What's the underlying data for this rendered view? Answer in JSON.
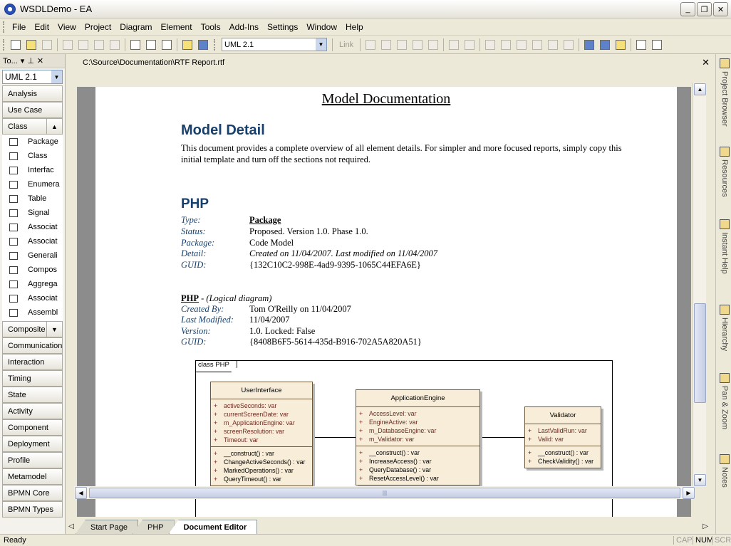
{
  "window": {
    "title": "WSDLDemo - EA"
  },
  "menu": [
    "File",
    "Edit",
    "View",
    "Project",
    "Diagram",
    "Element",
    "Tools",
    "Add-Ins",
    "Settings",
    "Window",
    "Help"
  ],
  "toolbar": {
    "uml_select": "UML 2.1",
    "link_label": "Link"
  },
  "toolbox": {
    "header": "To...",
    "selector": "UML 2.1",
    "top_categories": [
      "Analysis",
      "Use Case"
    ],
    "open_category": "Class",
    "tools": [
      {
        "label": "Package",
        "icon": "package-icon"
      },
      {
        "label": "Class",
        "icon": "class-icon"
      },
      {
        "label": "Interfac",
        "icon": "interface-icon"
      },
      {
        "label": "Enumera",
        "icon": "enumeration-icon"
      },
      {
        "label": "Table",
        "icon": "table-icon"
      },
      {
        "label": "Signal",
        "icon": "signal-icon"
      },
      {
        "label": "Associat",
        "icon": "association-icon"
      },
      {
        "label": "Associat",
        "icon": "association-line-icon"
      },
      {
        "label": "Generali",
        "icon": "generalization-icon"
      },
      {
        "label": "Compos",
        "icon": "composition-icon"
      },
      {
        "label": "Aggrega",
        "icon": "aggregation-icon"
      },
      {
        "label": "Associat",
        "icon": "association-class-icon"
      },
      {
        "label": "Assembl",
        "icon": "assembly-icon"
      }
    ],
    "bottom_categories": [
      "Composite",
      "Communication",
      "Interaction",
      "Timing",
      "State",
      "Activity",
      "Component",
      "Deployment",
      "Profile",
      "Metamodel",
      "BPMN Core",
      "BPMN Types"
    ]
  },
  "document": {
    "path": "C:\\Source\\Documentation\\RTF Report.rtf",
    "title": "Model Documentation",
    "heading": "Model Detail",
    "intro": "This document provides a complete overview of all element details. For simpler and more focused reports, simply copy this initial template and turn off the sections not required.",
    "package_heading": "PHP",
    "package_props": [
      {
        "label": "Type:",
        "value": "Package"
      },
      {
        "label": "Status:",
        "value": "Proposed. Version 1.0. Phase 1.0."
      },
      {
        "label": "Package:",
        "value": "Code Model"
      },
      {
        "label": "Detail:",
        "value": "Created on 11/04/2007. Last modified on 11/04/2007"
      },
      {
        "label": "GUID:",
        "value": "{132C10C2-998E-4ad9-9395-1065C44EFA6E}"
      }
    ],
    "diagram_name": "PHP",
    "diagram_kind": " - (Logical diagram)",
    "diagram_props": [
      {
        "label": "Created By:",
        "value": "Tom O'Reilly on 11/04/2007"
      },
      {
        "label": "Last Modified:",
        "value": "11/04/2007"
      },
      {
        "label": "Version:",
        "value": "1.0. Locked: False"
      },
      {
        "label": "GUID:",
        "value": "{8408B6F5-5614-435d-B916-702A5A820A51}"
      }
    ],
    "diagram_frame": "class PHP",
    "classes": [
      {
        "name": "UserInterface",
        "attrs": [
          "activeSeconds:  var",
          "currentScreenDate:  var",
          "m_ApplicationEngine:  var",
          "screenResolution:  var",
          "Timeout:  var"
        ],
        "ops": [
          "__construct() : var",
          "ChangeActiveSeconds() : var",
          "MarkedOperations() : var",
          "QueryTimeout() : var"
        ]
      },
      {
        "name": "ApplicationEngine",
        "attrs": [
          "AccessLevel:  var",
          "EngineActive:  var",
          "m_DatabaseEngine:  var",
          "m_Validator:  var"
        ],
        "ops": [
          "__construct() : var",
          "IncreaseAccess() : var",
          "QueryDatabase() : var",
          "ResetAccessLevel() : var"
        ]
      },
      {
        "name": "Validator",
        "attrs": [
          "LastValidRun:  var",
          "Valid:  var"
        ],
        "ops": [
          "__construct() : var",
          "CheckValidity() : var"
        ]
      }
    ]
  },
  "tabs": [
    "Start Page",
    "PHP",
    "Document Editor"
  ],
  "active_tab": "Document Editor",
  "right_panels": [
    "Project Browser",
    "Resources",
    "Instant Help",
    "Hierarchy",
    "Pan & Zoom",
    "Notes"
  ],
  "status": {
    "text": "Ready",
    "indicators": [
      "CAP",
      "NUM",
      "SCRL"
    ]
  }
}
